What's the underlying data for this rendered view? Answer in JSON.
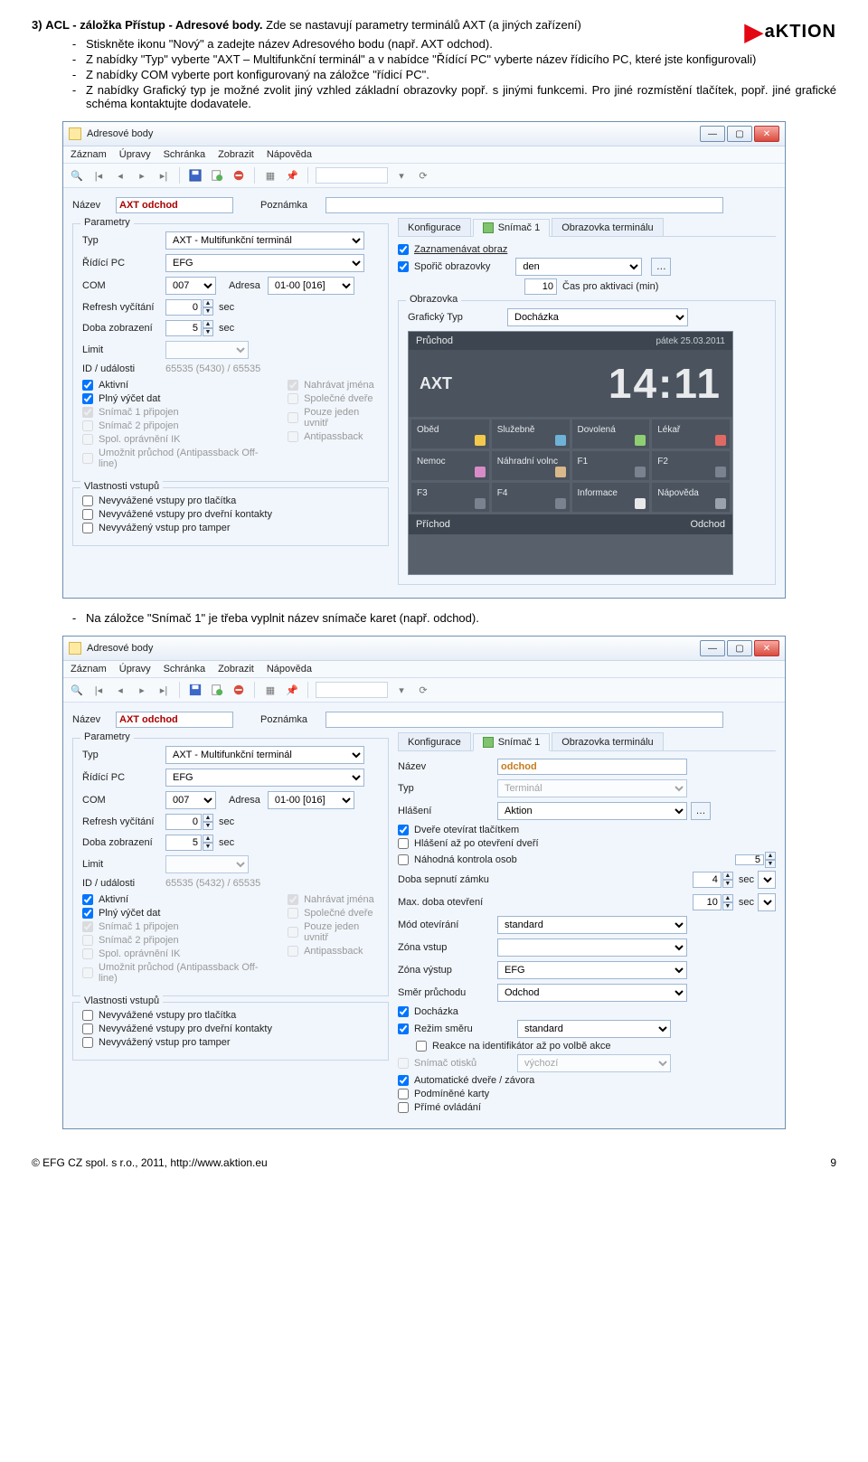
{
  "page_header_brand": "aKTION",
  "section": {
    "num": "3)",
    "title": "ACL - záložka Přístup - Adresové body.",
    "intro_rest": "Zde se nastavují parametry terminálů AXT (a jiných zařízení)",
    "bullets": [
      "Stiskněte ikonu \"Nový\" a zadejte název Adresového bodu (např. AXT odchod).",
      "Z nabídky \"Typ\" vyberte \"AXT – Multifunkční terminál\" a v nabídce \"Řídící PC\" vyberte název řídicího PC, které jste konfigurovali)",
      "Z nabídky COM vyberte port konfigurovaný na záložce \"řídicí PC\".",
      "Z nabídky Grafický typ je možné zvolit jiný vzhled základní obrazovky popř. s jinými funkcemi. Pro jiné rozmístění tlačítek, popř. jiné grafické schéma kontaktujte dodavatele."
    ],
    "mid_bullet": "Na záložce \"Snímač 1\" je třeba vyplnit název snímače karet (např. odchod)."
  },
  "win": {
    "title": "Adresové body",
    "menu": [
      "Záznam",
      "Úpravy",
      "Schránka",
      "Zobrazit",
      "Nápověda"
    ],
    "fields": {
      "name_lbl": "Název",
      "name_val": "AXT odchod",
      "note_lbl": "Poznámka",
      "note_val": "",
      "params_lbl": "Parametry",
      "typ_lbl": "Typ",
      "typ_val": "AXT - Multifunkční terminál",
      "ridici_lbl": "Řídící PC",
      "ridici_val": "EFG",
      "com_lbl": "COM",
      "com_val": "007",
      "adresa_lbl": "Adresa",
      "adresa_val": "01-00 [016]",
      "refresh_lbl": "Refresh vyčítání",
      "refresh_val": "0",
      "sec": "sec",
      "doba_lbl": "Doba zobrazení",
      "doba_val": "5",
      "limit_lbl": "Limit",
      "idu_lbl": "ID / události",
      "idu_val1": "65535 (5430) / 65535",
      "idu_val2": "65535 (5432) / 65535"
    },
    "chk_left_a": [
      {
        "t": "Aktivní",
        "c": true,
        "d": false
      },
      {
        "t": "Plný výčet dat",
        "c": true,
        "d": false
      },
      {
        "t": "Snímač 1 připojen",
        "c": true,
        "d": true
      },
      {
        "t": "Snímač 2 připojen",
        "c": false,
        "d": true
      },
      {
        "t": "Spol. oprávnění IK",
        "c": false,
        "d": true
      },
      {
        "t": "Umožnit průchod (Antipassback Off-line)",
        "c": false,
        "d": true
      }
    ],
    "chk_left_b": [
      {
        "t": "Nahrávat jména",
        "c": true,
        "d": true
      },
      {
        "t": "Společné dveře",
        "c": false,
        "d": true
      },
      {
        "t": "Pouze jeden uvnitř",
        "c": false,
        "d": true
      },
      {
        "t": "Antipassback",
        "c": false,
        "d": true
      }
    ],
    "vstup_lbl": "Vlastnosti vstupů",
    "chk_inputs": [
      {
        "t": "Nevyvážené vstupy pro tlačítka",
        "c": false
      },
      {
        "t": "Nevyvážené vstupy pro dveřní kontakty",
        "c": false
      },
      {
        "t": "Nevyvážený vstup pro tamper",
        "c": false
      }
    ],
    "tabs": [
      "Konfigurace",
      "Snímač 1",
      "Obrazovka terminálu"
    ],
    "konfig": {
      "chk_rec": "Zaznamenávat obraz",
      "chk_sporic": "Spořič obrazovky",
      "sporic_val": "den",
      "cas_val": "10",
      "cas_lbl": "Čas pro aktivaci (min)",
      "obraz_lbl": "Obrazovka",
      "graf_lbl": "Grafický Typ",
      "graf_val": "Docházka"
    },
    "terminal": {
      "bar": "Průchod",
      "date": "pátek 25.03.2011",
      "brand": "AXT",
      "time": "14:11",
      "cells": [
        "Oběd",
        "Služebně",
        "Dovolená",
        "Lékař",
        "Nemoc",
        "Náhradní volnc",
        "F1",
        "F2",
        "F3",
        "F4",
        "Informace",
        "Nápověda"
      ],
      "foot_l": "Příchod",
      "foot_r": "Odchod"
    },
    "snimac": {
      "nazev_lbl": "Název",
      "nazev_val": "odchod",
      "typ_lbl": "Typ",
      "typ_val": "Terminál",
      "hlas_lbl": "Hlášení",
      "hlas_val": "Aktion",
      "chk_a": [
        {
          "t": "Dveře otevírat tlačítkem",
          "c": true
        },
        {
          "t": "Hlášení až po otevření dveří",
          "c": false
        }
      ],
      "chk_b_l": "Náhodná kontrola osob",
      "chk_b_v": "5",
      "doba_sep_l": "Doba sepnutí zámku",
      "doba_sep_v": "4",
      "max_ot_l": "Max. doba otevření",
      "max_ot_v": "10",
      "mod_l": "Mód otevírání",
      "mod_v": "standard",
      "zv_l": "Zóna vstup",
      "zv_v": "",
      "zvy_l": "Zóna výstup",
      "zvy_v": "EFG",
      "smer_l": "Směr průchodu",
      "smer_v": "Odchod",
      "chk_c": [
        {
          "t": "Docházka",
          "c": true
        },
        {
          "t_pre": "Režim směru",
          "sel": "standard",
          "c": true,
          "row": true
        },
        {
          "t": "Reakce na identifikátor až po volbě akce",
          "c": false,
          "indent": true
        },
        {
          "t_pre": "Snímač otisků",
          "sel": "výchozí",
          "c": false,
          "row": true,
          "d": true
        },
        {
          "t": "Automatické dveře / závora",
          "c": true
        },
        {
          "t": "Podmíněné karty",
          "c": false
        },
        {
          "t": "Přímé ovládání",
          "c": false
        }
      ]
    }
  },
  "footer": {
    "left": "© EFG CZ spol. s r.o., 2011, http://www.aktion.eu",
    "right": "9"
  }
}
